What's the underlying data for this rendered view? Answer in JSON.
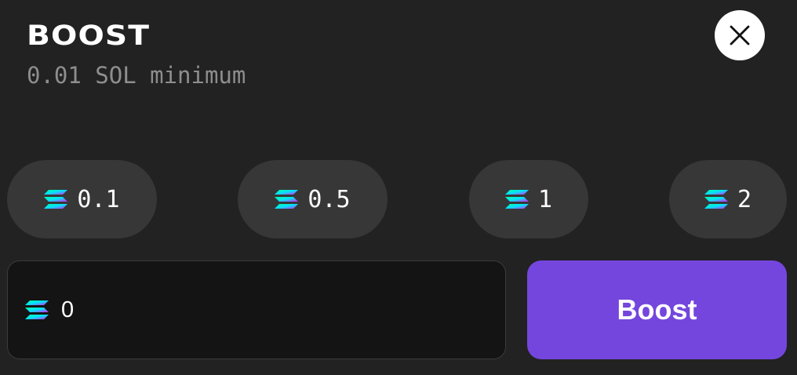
{
  "header": {
    "title": "BOOST",
    "subtitle": "0.01 SOL minimum",
    "close_icon": "close-icon"
  },
  "presets": [
    {
      "label": "0.1",
      "icon": "solana-icon"
    },
    {
      "label": "0.5",
      "icon": "solana-icon"
    },
    {
      "label": "1",
      "icon": "solana-icon"
    },
    {
      "label": "2",
      "icon": "solana-icon"
    }
  ],
  "amount": {
    "value": "0",
    "icon": "solana-icon"
  },
  "submit": {
    "label": "Boost"
  },
  "colors": {
    "background": "#222222",
    "chip": "#373737",
    "input_bg": "#141414",
    "accent": "#7446dd",
    "muted_text": "#8e8e8e",
    "solana_gradient": [
      "#00ffa3",
      "#03e1ff",
      "#dc1fff"
    ]
  }
}
